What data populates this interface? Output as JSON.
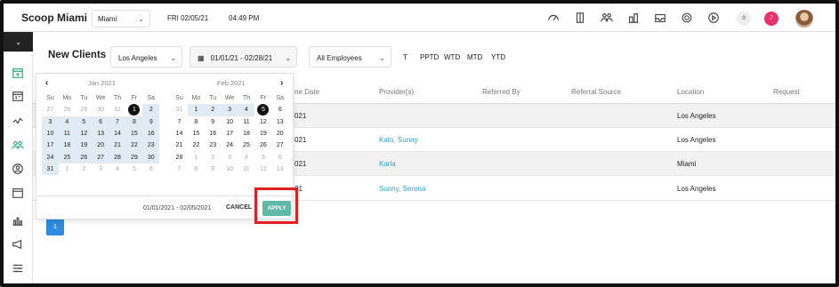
{
  "header": {
    "brand": "Scoop Miami",
    "location_select": "Miami",
    "date": "FRI 02/05/21",
    "time": "04:49 PM",
    "badge_count_gray": "0",
    "badge_count_red": "7",
    "icons": [
      "gauge-icon",
      "columns-icon",
      "team-icon",
      "building-icon",
      "inbox-icon",
      "settings-icon",
      "play-icon"
    ]
  },
  "sidebar": {
    "icons": [
      "calendar-plus-icon",
      "calendar-icon",
      "chart-line-icon",
      "users-icon",
      "clients-icon",
      "cash-register-icon",
      "bar-chart-icon",
      "megaphone-icon",
      "sliders-icon"
    ]
  },
  "main": {
    "title": "New Clients",
    "location_filter": "Los Angeles",
    "date_filter": "01/01/21 - 02/28/21",
    "employee_filter": "All Employees",
    "quick_filters": [
      "T",
      "PPTD",
      "WTD",
      "MTD",
      "YTD"
    ]
  },
  "table": {
    "headers": [
      "ne Date",
      "Provider(s)",
      "Referred By",
      "Referral Source",
      "Location",
      "Request"
    ],
    "rows": [
      {
        "date": "021",
        "providers": "",
        "location": "Los Angeles"
      },
      {
        "date": "021",
        "providers": "Kato, Sunny",
        "location": "Los Angeles"
      },
      {
        "date": "021",
        "providers": "Karla",
        "location": "Miami"
      },
      {
        "date": "21",
        "providers": "Sunny, Serena",
        "location": "Los Angeles"
      }
    ]
  },
  "pager": {
    "current_page": "1"
  },
  "calendar": {
    "prev": "‹",
    "next": "›",
    "weekdays": [
      "Su",
      "Mo",
      "Tu",
      "We",
      "Th",
      "Fr",
      "Sa"
    ],
    "left": {
      "title": "Jan 2021",
      "days": [
        "27",
        "28",
        "29",
        "30",
        "31",
        "1",
        "2",
        "3",
        "4",
        "5",
        "6",
        "7",
        "8",
        "9",
        "10",
        "11",
        "12",
        "13",
        "14",
        "15",
        "16",
        "17",
        "18",
        "19",
        "20",
        "21",
        "22",
        "23",
        "24",
        "25",
        "26",
        "27",
        "28",
        "29",
        "30",
        "31",
        "1",
        "2",
        "3",
        "4",
        "5",
        "6"
      ]
    },
    "right": {
      "title": "Feb 2021",
      "days": [
        "31",
        "1",
        "2",
        "3",
        "4",
        "5",
        "6",
        "7",
        "8",
        "9",
        "10",
        "11",
        "12",
        "13",
        "14",
        "15",
        "16",
        "17",
        "18",
        "19",
        "20",
        "21",
        "22",
        "23",
        "24",
        "25",
        "26",
        "27",
        "28",
        "1",
        "2",
        "3",
        "4",
        "5",
        "6",
        "7",
        "8",
        "9",
        "10",
        "11",
        "12",
        "13"
      ]
    },
    "range_text": "01/01/2021 - 02/05/2021",
    "cancel_label": "CANCEL",
    "apply_label": "APPLY",
    "highlight_color": "#e02020",
    "apply_color": "#5fb9a6"
  }
}
